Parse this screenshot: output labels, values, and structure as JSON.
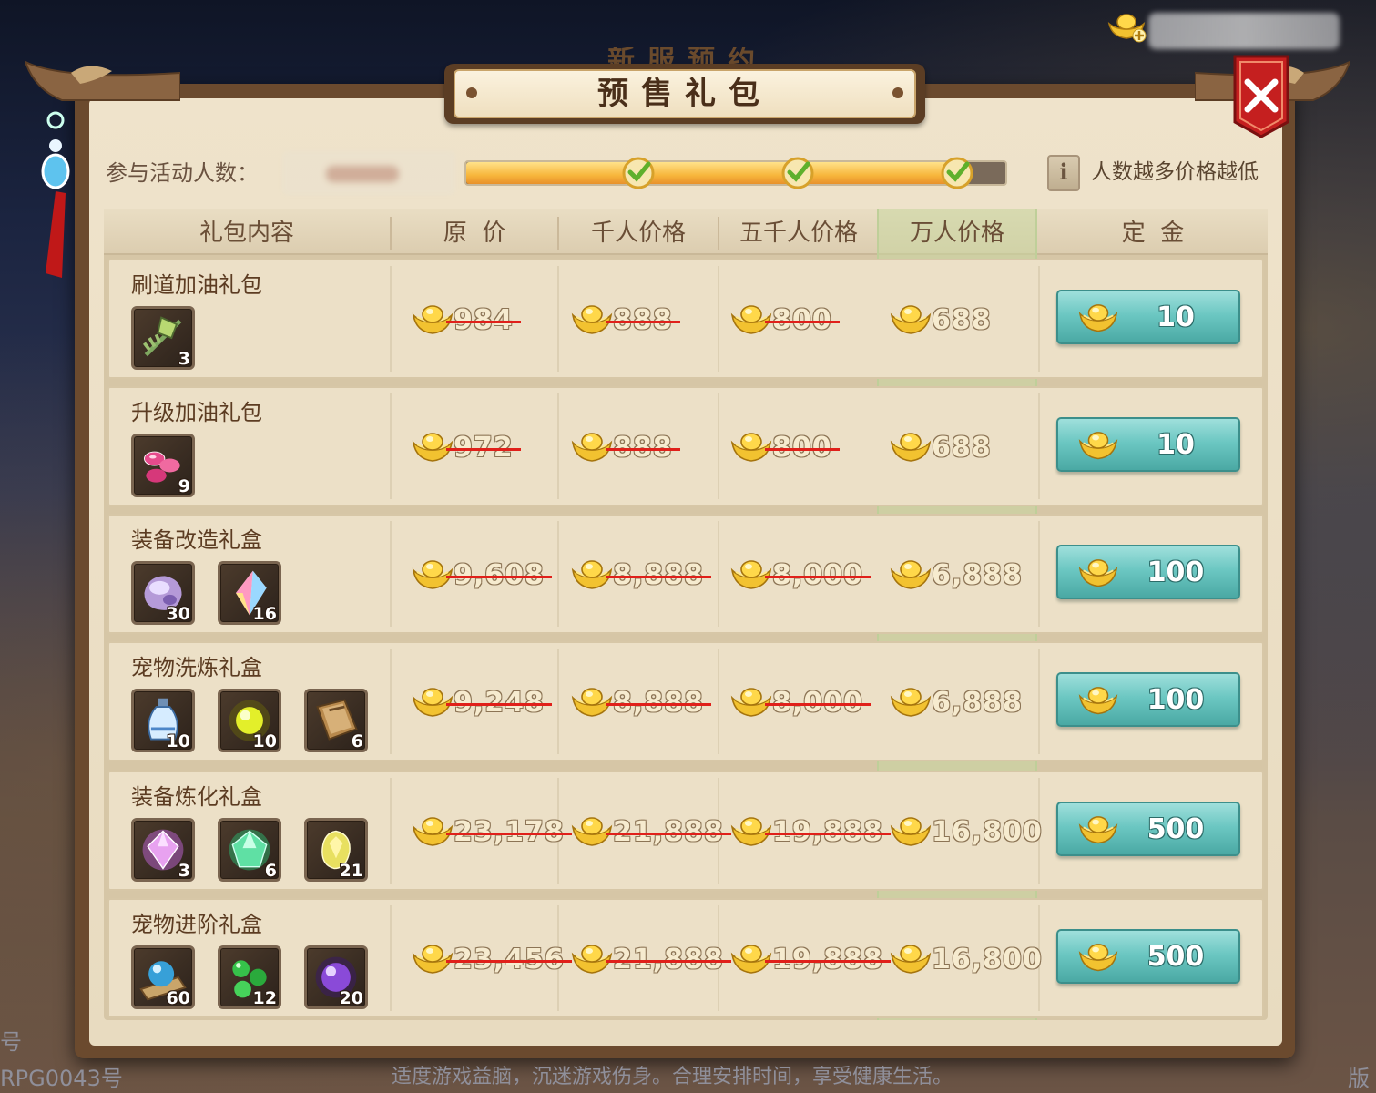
{
  "title_behind": "新服预约",
  "title": "预售礼包",
  "participants": {
    "label": "参与活动人数：",
    "progress": 0.93,
    "milestones_reached": 3
  },
  "hint": "人数越多价格越低",
  "info_icon_glyph": "i",
  "columns": [
    "礼包内容",
    "原  价",
    "千人价格",
    "五千人价格",
    "万人价格",
    "定  金"
  ],
  "packages": [
    {
      "name": "刷道加油礼包",
      "items": [
        {
          "icon": "green-feather-charm-icon",
          "qty": "3"
        }
      ],
      "original": "984",
      "price_1k": "888",
      "price_5k": "800",
      "price_10k": "688",
      "deposit": "10"
    },
    {
      "name": "升级加油礼包",
      "items": [
        {
          "icon": "pink-pills-icon",
          "qty": "9"
        }
      ],
      "original": "972",
      "price_1k": "888",
      "price_5k": "800",
      "price_10k": "688",
      "deposit": "10"
    },
    {
      "name": "装备改造礼盒",
      "items": [
        {
          "icon": "purple-stone-icon",
          "qty": "30"
        },
        {
          "icon": "rainbow-crystal-icon",
          "qty": "16"
        }
      ],
      "original": "9,608",
      "price_1k": "8,888",
      "price_5k": "8,000",
      "price_10k": "6,888",
      "deposit": "100"
    },
    {
      "name": "宠物洗炼礼盒",
      "items": [
        {
          "icon": "blue-vase-icon",
          "qty": "10"
        },
        {
          "icon": "yellow-orb-icon",
          "qty": "10"
        },
        {
          "icon": "book-icon",
          "qty": "6"
        }
      ],
      "original": "9,248",
      "price_1k": "8,888",
      "price_5k": "8,000",
      "price_10k": "6,888",
      "deposit": "100"
    },
    {
      "name": "装备炼化礼盒",
      "items": [
        {
          "icon": "pink-gem-icon",
          "qty": "3"
        },
        {
          "icon": "green-gem-icon",
          "qty": "6"
        },
        {
          "icon": "yellow-gem-icon",
          "qty": "21"
        }
      ],
      "original": "23,178",
      "price_1k": "21,888",
      "price_5k": "19,888",
      "price_10k": "16,800",
      "deposit": "500"
    },
    {
      "name": "宠物进阶礼盒",
      "items": [
        {
          "icon": "blue-orb-scroll-icon",
          "qty": "60"
        },
        {
          "icon": "green-beads-icon",
          "qty": "12"
        },
        {
          "icon": "purple-orb-icon",
          "qty": "20"
        }
      ],
      "original": "23,456",
      "price_1k": "21,888",
      "price_5k": "19,888",
      "price_10k": "16,800",
      "deposit": "500"
    }
  ],
  "footer": "适度游戏益脑，沉迷游戏伤身。合理安排时间，享受健康生活。",
  "side_left_1": "号",
  "side_left_2": "RPG0043号",
  "side_right": "版",
  "colors": {
    "strike": "#e0201a",
    "deposit_button": "#6cc7c2",
    "highlight_column": "#c8d7a0",
    "gold": "#f2c230"
  }
}
